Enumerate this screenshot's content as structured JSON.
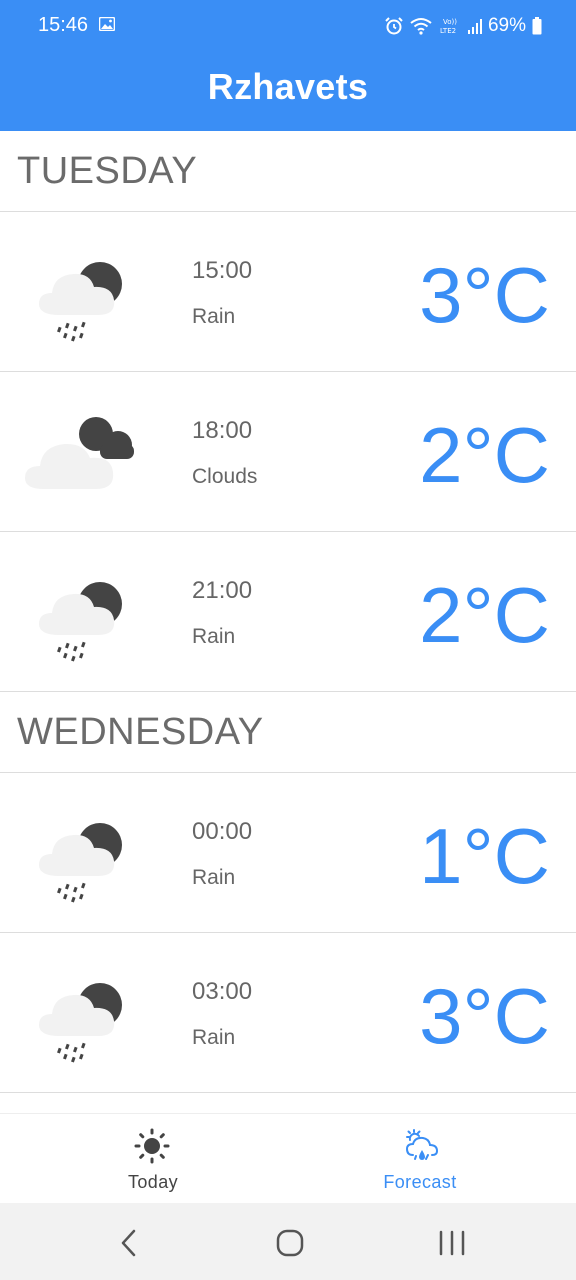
{
  "status_bar": {
    "time": "15:46",
    "battery": "69%",
    "icons": [
      "gallery-icon",
      "alarm-icon",
      "wifi-icon",
      "volte-lte2-icon",
      "signal-icon",
      "battery-icon"
    ]
  },
  "app_bar": {
    "title": "Rzhavets"
  },
  "days": [
    {
      "label": "TUESDAY",
      "rows": [
        {
          "time": "15:00",
          "condition": "Rain",
          "temp": "3°C",
          "icon": "rain-night-icon"
        },
        {
          "time": "18:00",
          "condition": "Clouds",
          "temp": "2°C",
          "icon": "clouds-night-icon"
        },
        {
          "time": "21:00",
          "condition": "Rain",
          "temp": "2°C",
          "icon": "rain-night-icon"
        }
      ]
    },
    {
      "label": "WEDNESDAY",
      "rows": [
        {
          "time": "00:00",
          "condition": "Rain",
          "temp": "1°C",
          "icon": "rain-night-icon"
        },
        {
          "time": "03:00",
          "condition": "Rain",
          "temp": "3°C",
          "icon": "rain-night-icon"
        }
      ]
    }
  ],
  "bottom_nav": {
    "today_label": "Today",
    "forecast_label": "Forecast",
    "active": "forecast",
    "active_color": "#3a8ef5"
  },
  "colors": {
    "accent": "#3a8ef5",
    "text_secondary": "#666666"
  }
}
